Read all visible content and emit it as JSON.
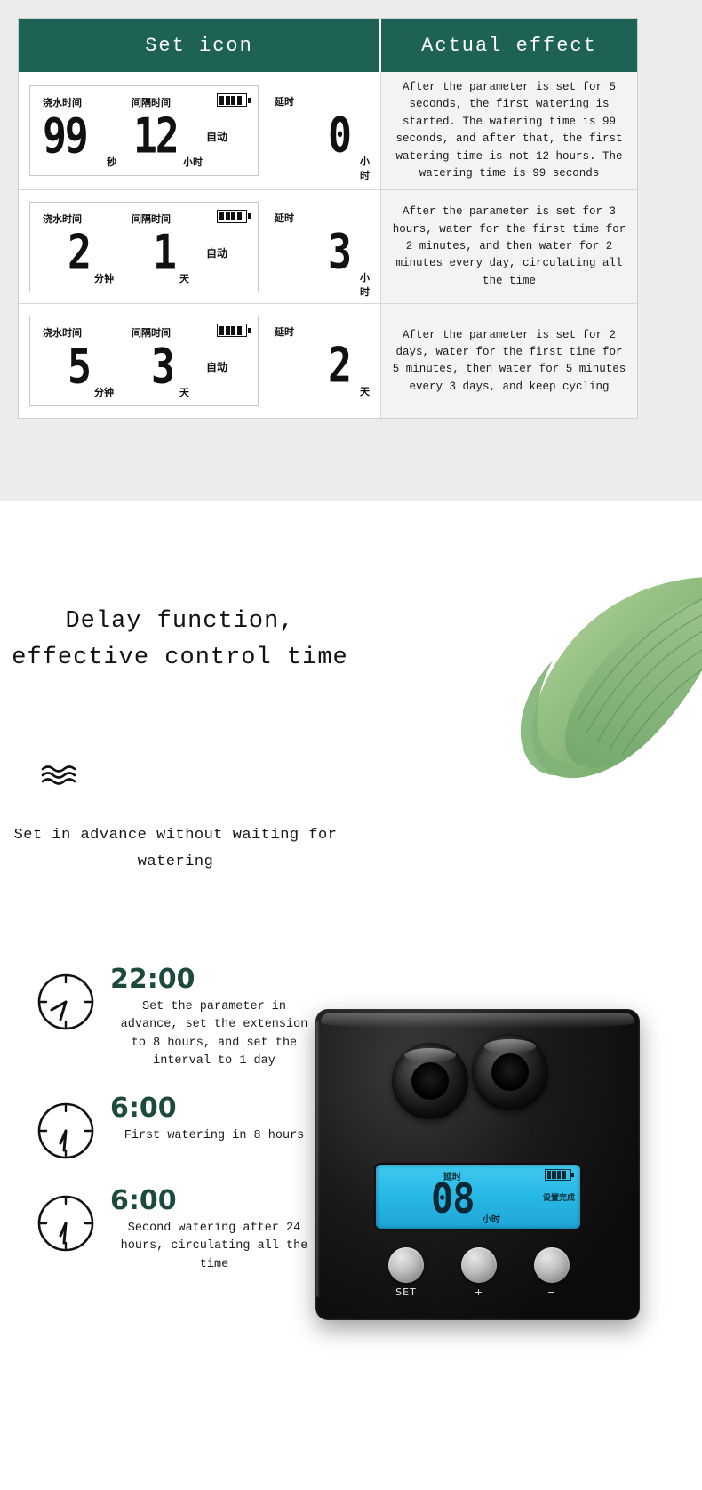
{
  "table": {
    "headers": {
      "set_icon": "Set icon",
      "actual_effect": "Actual effect"
    },
    "header_bg": "#1d6254",
    "labels": {
      "watering_time": "浇水时间",
      "interval_time": "间隔时间",
      "auto": "自动",
      "delay": "延时",
      "battery": "battery-full-icon"
    },
    "rows": [
      {
        "watering_value": "99",
        "watering_unit": "秒",
        "interval_value": "12",
        "interval_unit": "小时",
        "delay_value": "0",
        "delay_unit": "小时",
        "effect": "After the parameter is set for 5 seconds, the first watering is started. The watering time is 99 seconds, and after that, the first watering time is not 12 hours. The watering time is 99 seconds"
      },
      {
        "watering_value": "2",
        "watering_unit": "分钟",
        "interval_value": "1",
        "interval_unit": "天",
        "delay_value": "3",
        "delay_unit": "小时",
        "effect": "After the parameter is set for 3 hours, water for the first time for 2 minutes, and then water for 2 minutes every day, circulating all the time"
      },
      {
        "watering_value": "5",
        "watering_unit": "分钟",
        "interval_value": "3",
        "interval_unit": "天",
        "delay_value": "2",
        "delay_unit": "天",
        "effect": "After the parameter is set for 2 days, water for the first time for 5 minutes, then water for 5 minutes every 3 days, and keep cycling"
      }
    ]
  },
  "hero": {
    "title": "Delay function, effective control time",
    "wave_icon": "water-waves-icon",
    "subtitle": "Set in advance without waiting for watering",
    "leaf_icon": "green-leaf-image"
  },
  "timeline": {
    "accent_color": "#1d4a3c",
    "items": [
      {
        "time": "22:00",
        "clock_icon": "clock-icon",
        "desc": "Set the parameter in advance, set the extension to 8 hours, and set the interval to 1 day"
      },
      {
        "time": "6:00",
        "clock_icon": "clock-icon",
        "desc": "First watering in 8 hours"
      },
      {
        "time": "6:00",
        "clock_icon": "clock-icon",
        "desc": "Second watering after 24 hours, circulating all the time"
      }
    ]
  },
  "device": {
    "lcd": {
      "delay_label": "延时",
      "digits": "08",
      "unit": "小时",
      "status": "设置完成",
      "battery": "battery-full-icon",
      "backlight_color": "#27b9e6"
    },
    "buttons": [
      {
        "label": "SET"
      },
      {
        "label": "+"
      },
      {
        "label": "−"
      }
    ]
  }
}
